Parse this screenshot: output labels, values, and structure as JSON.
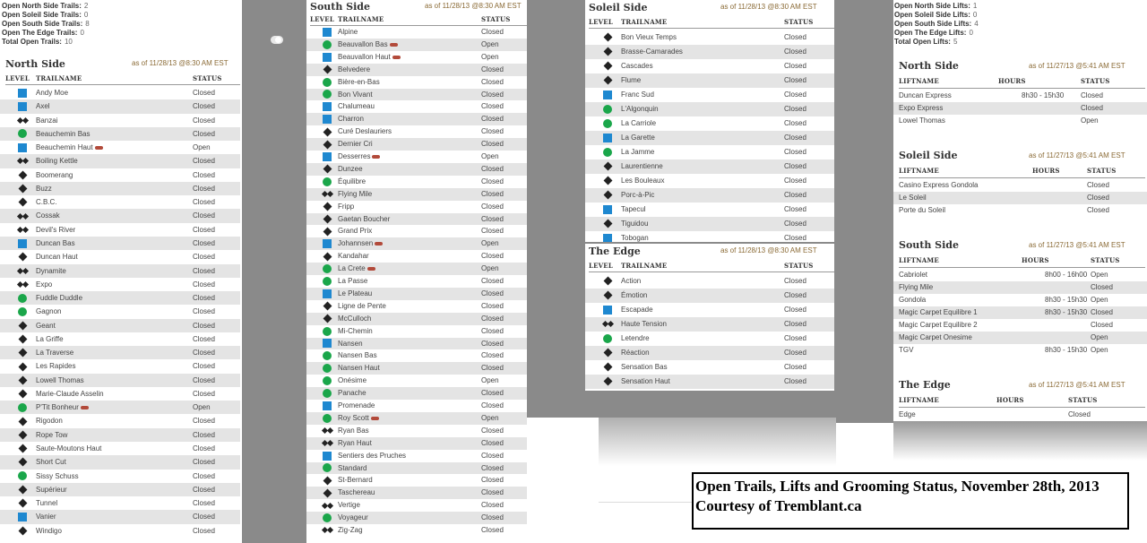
{
  "trails_summary": [
    {
      "label": "Open North Side Trails:",
      "value": "2"
    },
    {
      "label": "Open Soleil Side Trails:",
      "value": "0"
    },
    {
      "label": "Open South Side Trails:",
      "value": "8"
    },
    {
      "label": "Open The Edge Trails:",
      "value": "0"
    },
    {
      "label": "Total Open Trails:",
      "value": "10"
    }
  ],
  "lifts_summary": [
    {
      "label": "Open North Side Lifts:",
      "value": "1"
    },
    {
      "label": "Open Soleil Side Lifts:",
      "value": "0"
    },
    {
      "label": "Open South Side Lifts:",
      "value": "4"
    },
    {
      "label": "Open The Edge Lifts:",
      "value": "0"
    },
    {
      "label": "Total Open Lifts:",
      "value": "5"
    }
  ],
  "trail_headers": {
    "level": "LEVEL",
    "trailname": "TRAILNAME",
    "status": "STATUS"
  },
  "lift_headers": {
    "liftname": "LIFTNAME",
    "hours": "HOURS",
    "status": "STATUS"
  },
  "north_trails": {
    "title": "North Side",
    "asof": "as of 11/28/13 @8:30 AM EST",
    "rows": [
      {
        "lvl": "b",
        "name": "Andy Moe",
        "status": "Closed"
      },
      {
        "lvl": "b",
        "name": "Axel",
        "status": "Closed"
      },
      {
        "lvl": "dd",
        "name": "Banzai",
        "status": "Closed"
      },
      {
        "lvl": "g",
        "name": "Beauchemin Bas",
        "status": "Closed"
      },
      {
        "lvl": "b",
        "name": "Beauchemin Haut",
        "status": "Open",
        "groom": true
      },
      {
        "lvl": "dd",
        "name": "Boiling Kettle",
        "status": "Closed"
      },
      {
        "lvl": "d",
        "name": "Boomerang",
        "status": "Closed"
      },
      {
        "lvl": "d",
        "name": "Buzz",
        "status": "Closed"
      },
      {
        "lvl": "d",
        "name": "C.B.C.",
        "status": "Closed"
      },
      {
        "lvl": "dd",
        "name": "Cossak",
        "status": "Closed"
      },
      {
        "lvl": "dd",
        "name": "Devil's River",
        "status": "Closed"
      },
      {
        "lvl": "b",
        "name": "Duncan Bas",
        "status": "Closed"
      },
      {
        "lvl": "d",
        "name": "Duncan Haut",
        "status": "Closed"
      },
      {
        "lvl": "dd",
        "name": "Dynamite",
        "status": "Closed"
      },
      {
        "lvl": "dd",
        "name": "Expo",
        "status": "Closed"
      },
      {
        "lvl": "g",
        "name": "Fuddle Duddle",
        "status": "Closed"
      },
      {
        "lvl": "g",
        "name": "Gagnon",
        "status": "Closed"
      },
      {
        "lvl": "d",
        "name": "Geant",
        "status": "Closed"
      },
      {
        "lvl": "d",
        "name": "La Griffe",
        "status": "Closed"
      },
      {
        "lvl": "d",
        "name": "La Traverse",
        "status": "Closed"
      },
      {
        "lvl": "d",
        "name": "Les Rapides",
        "status": "Closed"
      },
      {
        "lvl": "d",
        "name": "Lowell Thomas",
        "status": "Closed"
      },
      {
        "lvl": "d",
        "name": "Marie-Claude Asselin",
        "status": "Closed"
      },
      {
        "lvl": "g",
        "name": "P'Tit Bonheur",
        "status": "Open",
        "groom": true
      },
      {
        "lvl": "d",
        "name": "Rigodon",
        "status": "Closed"
      },
      {
        "lvl": "d",
        "name": "Rope Tow",
        "status": "Closed"
      },
      {
        "lvl": "d",
        "name": "Saute-Moutons Haut",
        "status": "Closed"
      },
      {
        "lvl": "d",
        "name": "Short Cut",
        "status": "Closed"
      },
      {
        "lvl": "g",
        "name": "Sissy Schuss",
        "status": "Closed"
      },
      {
        "lvl": "d",
        "name": "Supérieur",
        "status": "Closed"
      },
      {
        "lvl": "d",
        "name": "Tunnel",
        "status": "Closed"
      },
      {
        "lvl": "b",
        "name": "Vanier",
        "status": "Closed"
      },
      {
        "lvl": "d",
        "name": "Windigo",
        "status": "Closed"
      }
    ]
  },
  "south_trails": {
    "title": "South Side",
    "asof": "as of 11/28/13 @8:30 AM EST",
    "rows": [
      {
        "lvl": "b",
        "name": "Alpine",
        "status": "Closed"
      },
      {
        "lvl": "g",
        "name": "Beauvallon Bas",
        "status": "Open",
        "groom": true
      },
      {
        "lvl": "b",
        "name": "Beauvallon Haut",
        "status": "Open",
        "groom": true
      },
      {
        "lvl": "d",
        "name": "Belvedere",
        "status": "Closed"
      },
      {
        "lvl": "g",
        "name": "Bière-en-Bas",
        "status": "Closed"
      },
      {
        "lvl": "g",
        "name": "Bon Vivant",
        "status": "Closed"
      },
      {
        "lvl": "b",
        "name": "Chalumeau",
        "status": "Closed"
      },
      {
        "lvl": "b",
        "name": "Charron",
        "status": "Closed"
      },
      {
        "lvl": "d",
        "name": "Curé Deslauriers",
        "status": "Closed"
      },
      {
        "lvl": "d",
        "name": "Dernier Cri",
        "status": "Closed"
      },
      {
        "lvl": "b",
        "name": "Desserres",
        "status": "Open",
        "groom": true
      },
      {
        "lvl": "d",
        "name": "Dunzee",
        "status": "Closed"
      },
      {
        "lvl": "g",
        "name": "Équilibre",
        "status": "Closed"
      },
      {
        "lvl": "dd",
        "name": "Flying Mile",
        "status": "Closed"
      },
      {
        "lvl": "d",
        "name": "Fripp",
        "status": "Closed"
      },
      {
        "lvl": "d",
        "name": "Gaetan Boucher",
        "status": "Closed"
      },
      {
        "lvl": "d",
        "name": "Grand Prix",
        "status": "Closed"
      },
      {
        "lvl": "b",
        "name": "Johannsen",
        "status": "Open",
        "groom": true
      },
      {
        "lvl": "d",
        "name": "Kandahar",
        "status": "Closed"
      },
      {
        "lvl": "g",
        "name": "La Crete",
        "status": "Open",
        "groom": true
      },
      {
        "lvl": "g",
        "name": "La Passe",
        "status": "Closed"
      },
      {
        "lvl": "b",
        "name": "Le Plateau",
        "status": "Closed"
      },
      {
        "lvl": "d",
        "name": "Ligne de Pente",
        "status": "Closed"
      },
      {
        "lvl": "d",
        "name": "McCulloch",
        "status": "Closed"
      },
      {
        "lvl": "g",
        "name": "Mi-Chemin",
        "status": "Closed"
      },
      {
        "lvl": "b",
        "name": "Nansen",
        "status": "Closed"
      },
      {
        "lvl": "g",
        "name": "Nansen Bas",
        "status": "Closed"
      },
      {
        "lvl": "g",
        "name": "Nansen Haut",
        "status": "Closed"
      },
      {
        "lvl": "g",
        "name": "Onésime",
        "status": "Open"
      },
      {
        "lvl": "g",
        "name": "Panache",
        "status": "Closed"
      },
      {
        "lvl": "b",
        "name": "Promenade",
        "status": "Closed"
      },
      {
        "lvl": "g",
        "name": "Roy Scott",
        "status": "Open",
        "groom": true
      },
      {
        "lvl": "dd",
        "name": "Ryan Bas",
        "status": "Closed"
      },
      {
        "lvl": "dd",
        "name": "Ryan Haut",
        "status": "Closed"
      },
      {
        "lvl": "b",
        "name": "Sentiers des Pruches",
        "status": "Closed"
      },
      {
        "lvl": "g",
        "name": "Standard",
        "status": "Closed"
      },
      {
        "lvl": "d",
        "name": "St-Bernard",
        "status": "Closed"
      },
      {
        "lvl": "d",
        "name": "Taschereau",
        "status": "Closed"
      },
      {
        "lvl": "dd",
        "name": "Vertige",
        "status": "Closed"
      },
      {
        "lvl": "g",
        "name": "Voyageur",
        "status": "Closed"
      },
      {
        "lvl": "dd",
        "name": "Zig-Zag",
        "status": "Closed"
      }
    ]
  },
  "soleil_trails": {
    "title": "Soleil Side",
    "asof": "as of 11/28/13 @8:30 AM EST",
    "rows": [
      {
        "lvl": "d",
        "name": "Bon Vieux Temps",
        "status": "Closed"
      },
      {
        "lvl": "d",
        "name": "Brasse-Camarades",
        "status": "Closed"
      },
      {
        "lvl": "d",
        "name": "Cascades",
        "status": "Closed"
      },
      {
        "lvl": "d",
        "name": "Flume",
        "status": "Closed"
      },
      {
        "lvl": "b",
        "name": "Franc Sud",
        "status": "Closed"
      },
      {
        "lvl": "g",
        "name": "L'Algonquin",
        "status": "Closed"
      },
      {
        "lvl": "g",
        "name": "La Carriole",
        "status": "Closed"
      },
      {
        "lvl": "b",
        "name": "La Garette",
        "status": "Closed"
      },
      {
        "lvl": "g",
        "name": "La Jamme",
        "status": "Closed"
      },
      {
        "lvl": "d",
        "name": "Laurentienne",
        "status": "Closed"
      },
      {
        "lvl": "d",
        "name": "Les Bouleaux",
        "status": "Closed"
      },
      {
        "lvl": "d",
        "name": "Porc-à-Pic",
        "status": "Closed"
      },
      {
        "lvl": "b",
        "name": "Tapecul",
        "status": "Closed"
      },
      {
        "lvl": "d",
        "name": "Tiguidou",
        "status": "Closed"
      },
      {
        "lvl": "b",
        "name": "Tobogan",
        "status": "Closed"
      }
    ]
  },
  "edge_trails": {
    "title": "The Edge",
    "asof": "as of 11/28/13 @8:30 AM EST",
    "rows": [
      {
        "lvl": "d",
        "name": "Action",
        "status": "Closed"
      },
      {
        "lvl": "d",
        "name": "Émotion",
        "status": "Closed"
      },
      {
        "lvl": "b",
        "name": "Escapade",
        "status": "Closed"
      },
      {
        "lvl": "dd",
        "name": "Haute Tension",
        "status": "Closed"
      },
      {
        "lvl": "g",
        "name": "Letendre",
        "status": "Closed"
      },
      {
        "lvl": "d",
        "name": "Réaction",
        "status": "Closed"
      },
      {
        "lvl": "d",
        "name": "Sensation Bas",
        "status": "Closed"
      },
      {
        "lvl": "d",
        "name": "Sensation Haut",
        "status": "Closed"
      }
    ]
  },
  "lift_sections": [
    {
      "title": "North Side",
      "asof": "as of 11/27/13 @5:41 AM EST",
      "rows": [
        {
          "name": "Duncan Express",
          "hours": "8h30 - 15h30",
          "status": "Closed"
        },
        {
          "name": "Expo Express",
          "hours": "",
          "status": "Closed"
        },
        {
          "name": "Lowel Thomas",
          "hours": "",
          "status": "Open"
        }
      ]
    },
    {
      "title": "Soleil Side",
      "asof": "as of 11/27/13 @5:41 AM EST",
      "rows": [
        {
          "name": "Casino Express Gondola",
          "hours": "",
          "status": "Closed"
        },
        {
          "name": "Le Soleil",
          "hours": "",
          "status": "Closed"
        },
        {
          "name": "Porte du Soleil",
          "hours": "",
          "status": "Closed"
        }
      ]
    },
    {
      "title": "South Side",
      "asof": "as of 11/27/13 @5:41 AM EST",
      "rows": [
        {
          "name": "Cabriolet",
          "hours": "8h00 - 16h00",
          "status": "Open"
        },
        {
          "name": "Flying Mile",
          "hours": "",
          "status": "Closed"
        },
        {
          "name": "Gondola",
          "hours": "8h30 - 15h30",
          "status": "Open"
        },
        {
          "name": "Magic Carpet Equilibre 1",
          "hours": "8h30 - 15h30",
          "status": "Closed"
        },
        {
          "name": "Magic Carpet Equilibre 2",
          "hours": "",
          "status": "Closed"
        },
        {
          "name": "Magic Carpet Onesime",
          "hours": "",
          "status": "Open"
        },
        {
          "name": "TGV",
          "hours": "8h30 - 15h30",
          "status": "Open"
        }
      ]
    },
    {
      "title": "The Edge",
      "asof": "as of 11/27/13 @5:41 AM EST",
      "rows": [
        {
          "name": "Edge",
          "hours": "",
          "status": "Closed"
        }
      ]
    }
  ],
  "caption": {
    "line1": "Open Trails, Lifts and Grooming Status, November 28th, 2013",
    "line2": "Courtesy of Tremblant.ca"
  }
}
